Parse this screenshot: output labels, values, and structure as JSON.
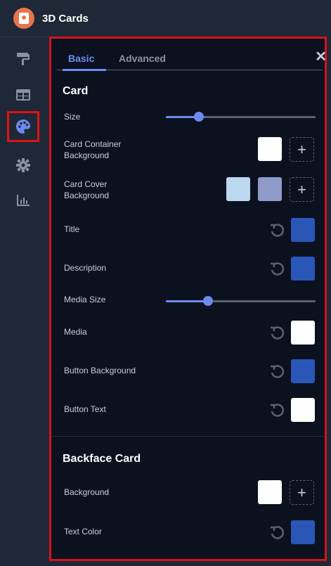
{
  "app": {
    "title": "3D Cards"
  },
  "tabs": {
    "basic": "Basic",
    "advanced": "Advanced"
  },
  "sections": {
    "card": "Card",
    "backface": "Backface Card"
  },
  "card_rows": {
    "size": {
      "label": "Size",
      "value": 0.25
    },
    "container_bg": {
      "label": "Card Container Background",
      "color": "#ffffff"
    },
    "cover_bg": {
      "label": "Card Cover Background",
      "colors": [
        "#bcd8f0",
        "#8e9ac9"
      ]
    },
    "title": {
      "label": "Title",
      "color": "#2a56b8"
    },
    "description": {
      "label": "Description",
      "color": "#2a56b8"
    },
    "media_size": {
      "label": "Media Size",
      "value": 0.28
    },
    "media": {
      "label": "Media",
      "color": "#ffffff"
    },
    "button_bg": {
      "label": "Button Background",
      "color": "#2a56b8"
    },
    "button_text": {
      "label": "Button Text",
      "color": "#ffffff"
    }
  },
  "backface_rows": {
    "background": {
      "label": "Background",
      "color": "#ffffff"
    },
    "text_color": {
      "label": "Text Color",
      "color": "#2a56b8"
    }
  },
  "icons": {
    "sidebar": [
      "paint-roller-icon",
      "table-icon",
      "palette-icon",
      "gear-icon",
      "bar-chart-icon"
    ],
    "close": "close-icon",
    "reset": "reset-icon",
    "add": "plus-icon"
  },
  "colors": {
    "accent": "#6d8bef",
    "highlight": "#d8131a"
  }
}
